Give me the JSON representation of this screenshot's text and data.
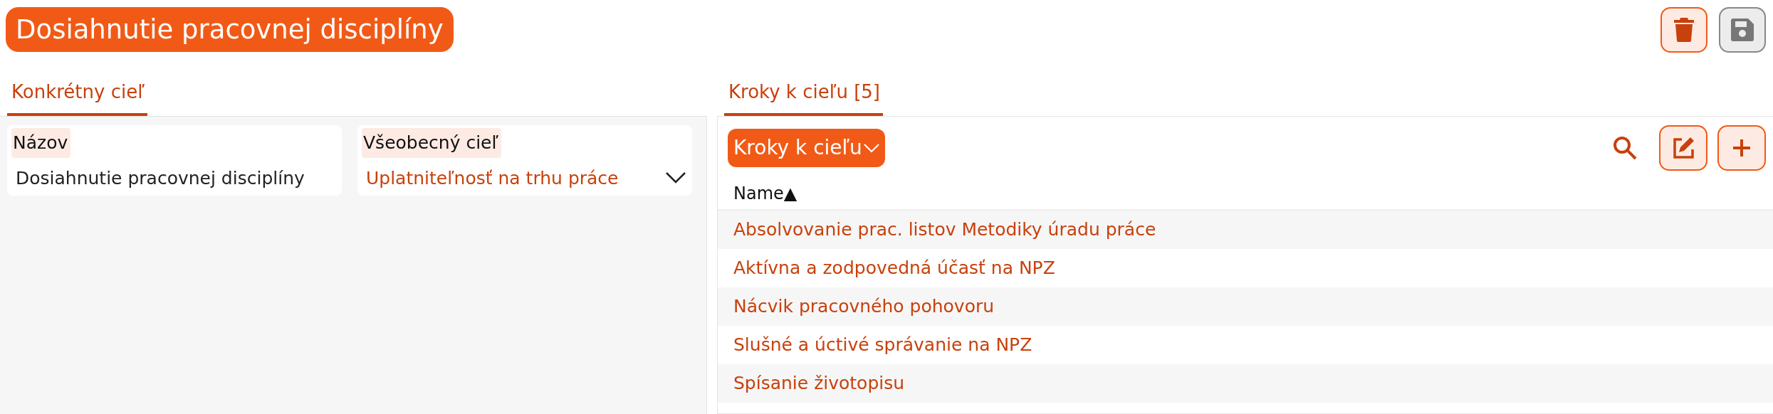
{
  "title": "Dosiahnutie pracovnej disciplíny",
  "toolbar": [
    {
      "kind": "delete",
      "disabled": false
    },
    {
      "kind": "save",
      "disabled": true
    }
  ],
  "left": {
    "tabs": [
      {
        "label": "Konkrétny cieľ",
        "selected": true
      }
    ],
    "fields": [
      {
        "kind": "text",
        "label": "Názov",
        "value": "Dosiahnutie pracovnej disciplíny"
      },
      {
        "kind": "select",
        "label": "Všeobecný cieľ",
        "value": "Uplatniteľnosť na trhu práce"
      }
    ]
  },
  "right": {
    "tabs": [
      {
        "label": "Kroky k cieľu [5]",
        "selected": true
      }
    ],
    "view_selector": "Kroky k cieľu",
    "actions": [
      {
        "kind": "search"
      },
      {
        "kind": "edit"
      },
      {
        "kind": "add"
      }
    ],
    "table": {
      "columns": [
        {
          "label": "Name",
          "sort_indicator": "▲"
        }
      ],
      "rows": [
        {
          "name": "Absolvovanie prac. listov Metodiky úradu práce"
        },
        {
          "name": "Aktívna a zodpovedná účasť na NPZ"
        },
        {
          "name": "Nácvik pracovného pohovoru"
        },
        {
          "name": "Slušné a úctivé správanie na NPZ"
        },
        {
          "name": "Spísanie životopisu"
        }
      ]
    }
  }
}
